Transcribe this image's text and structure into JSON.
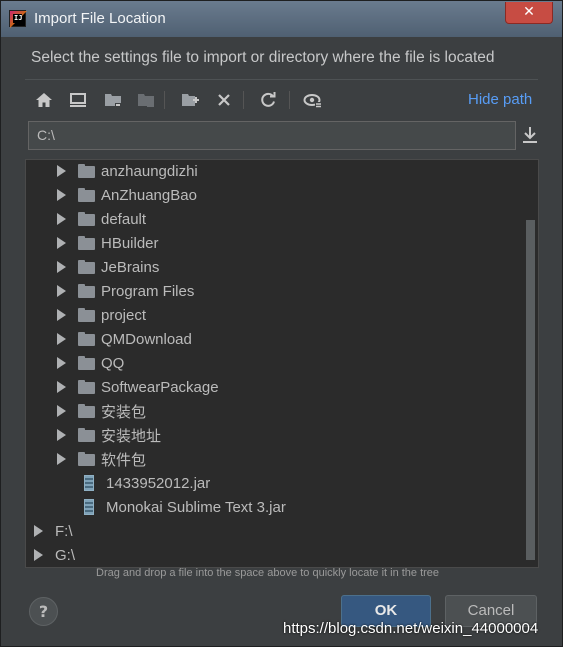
{
  "window": {
    "title": "Import File Location",
    "close_label": "✕"
  },
  "instruction": "Select the settings file to import or directory where the file is located",
  "toolbar": {
    "buttons": [
      "home-icon",
      "desktop-icon",
      "project-folder-icon",
      "module-folder-icon",
      "new-folder-icon",
      "delete-icon",
      "refresh-icon",
      "show-hidden-icon"
    ],
    "hide_path_label": "Hide path"
  },
  "path_field": {
    "value": "C:\\"
  },
  "tree": {
    "items": [
      {
        "label": "anzhaungdizhi",
        "type": "folder",
        "level": 1
      },
      {
        "label": "AnZhuangBao",
        "type": "folder",
        "level": 1
      },
      {
        "label": "default",
        "type": "folder",
        "level": 1
      },
      {
        "label": "HBuilder",
        "type": "folder",
        "level": 1
      },
      {
        "label": "JeBrains",
        "type": "folder",
        "level": 1
      },
      {
        "label": "Program Files",
        "type": "folder",
        "level": 1
      },
      {
        "label": "project",
        "type": "folder",
        "level": 1
      },
      {
        "label": "QMDownload",
        "type": "folder",
        "level": 1
      },
      {
        "label": "QQ",
        "type": "folder",
        "level": 1
      },
      {
        "label": "SoftwearPackage",
        "type": "folder",
        "level": 1
      },
      {
        "label": "安装包",
        "type": "folder",
        "level": 1
      },
      {
        "label": "安装地址",
        "type": "folder",
        "level": 1
      },
      {
        "label": "软件包",
        "type": "folder",
        "level": 1
      },
      {
        "label": "1433952012.jar",
        "type": "jar",
        "level": 1
      },
      {
        "label": "Monokai Sublime Text 3.jar",
        "type": "jar",
        "level": 1
      },
      {
        "label": "F:\\",
        "type": "drive",
        "level": 0
      },
      {
        "label": "G:\\",
        "type": "drive",
        "level": 0
      }
    ]
  },
  "hint": "Drag and drop a file into the space above to quickly locate it in the tree",
  "buttons": {
    "help": "?",
    "ok": "OK",
    "cancel": "Cancel"
  },
  "watermark": "https://blog.csdn.net/weixin_44000004",
  "colors": {
    "background": "#3c3f41",
    "tree_background": "#2b2b2b",
    "link": "#589df6",
    "ok_button": "#365880"
  }
}
